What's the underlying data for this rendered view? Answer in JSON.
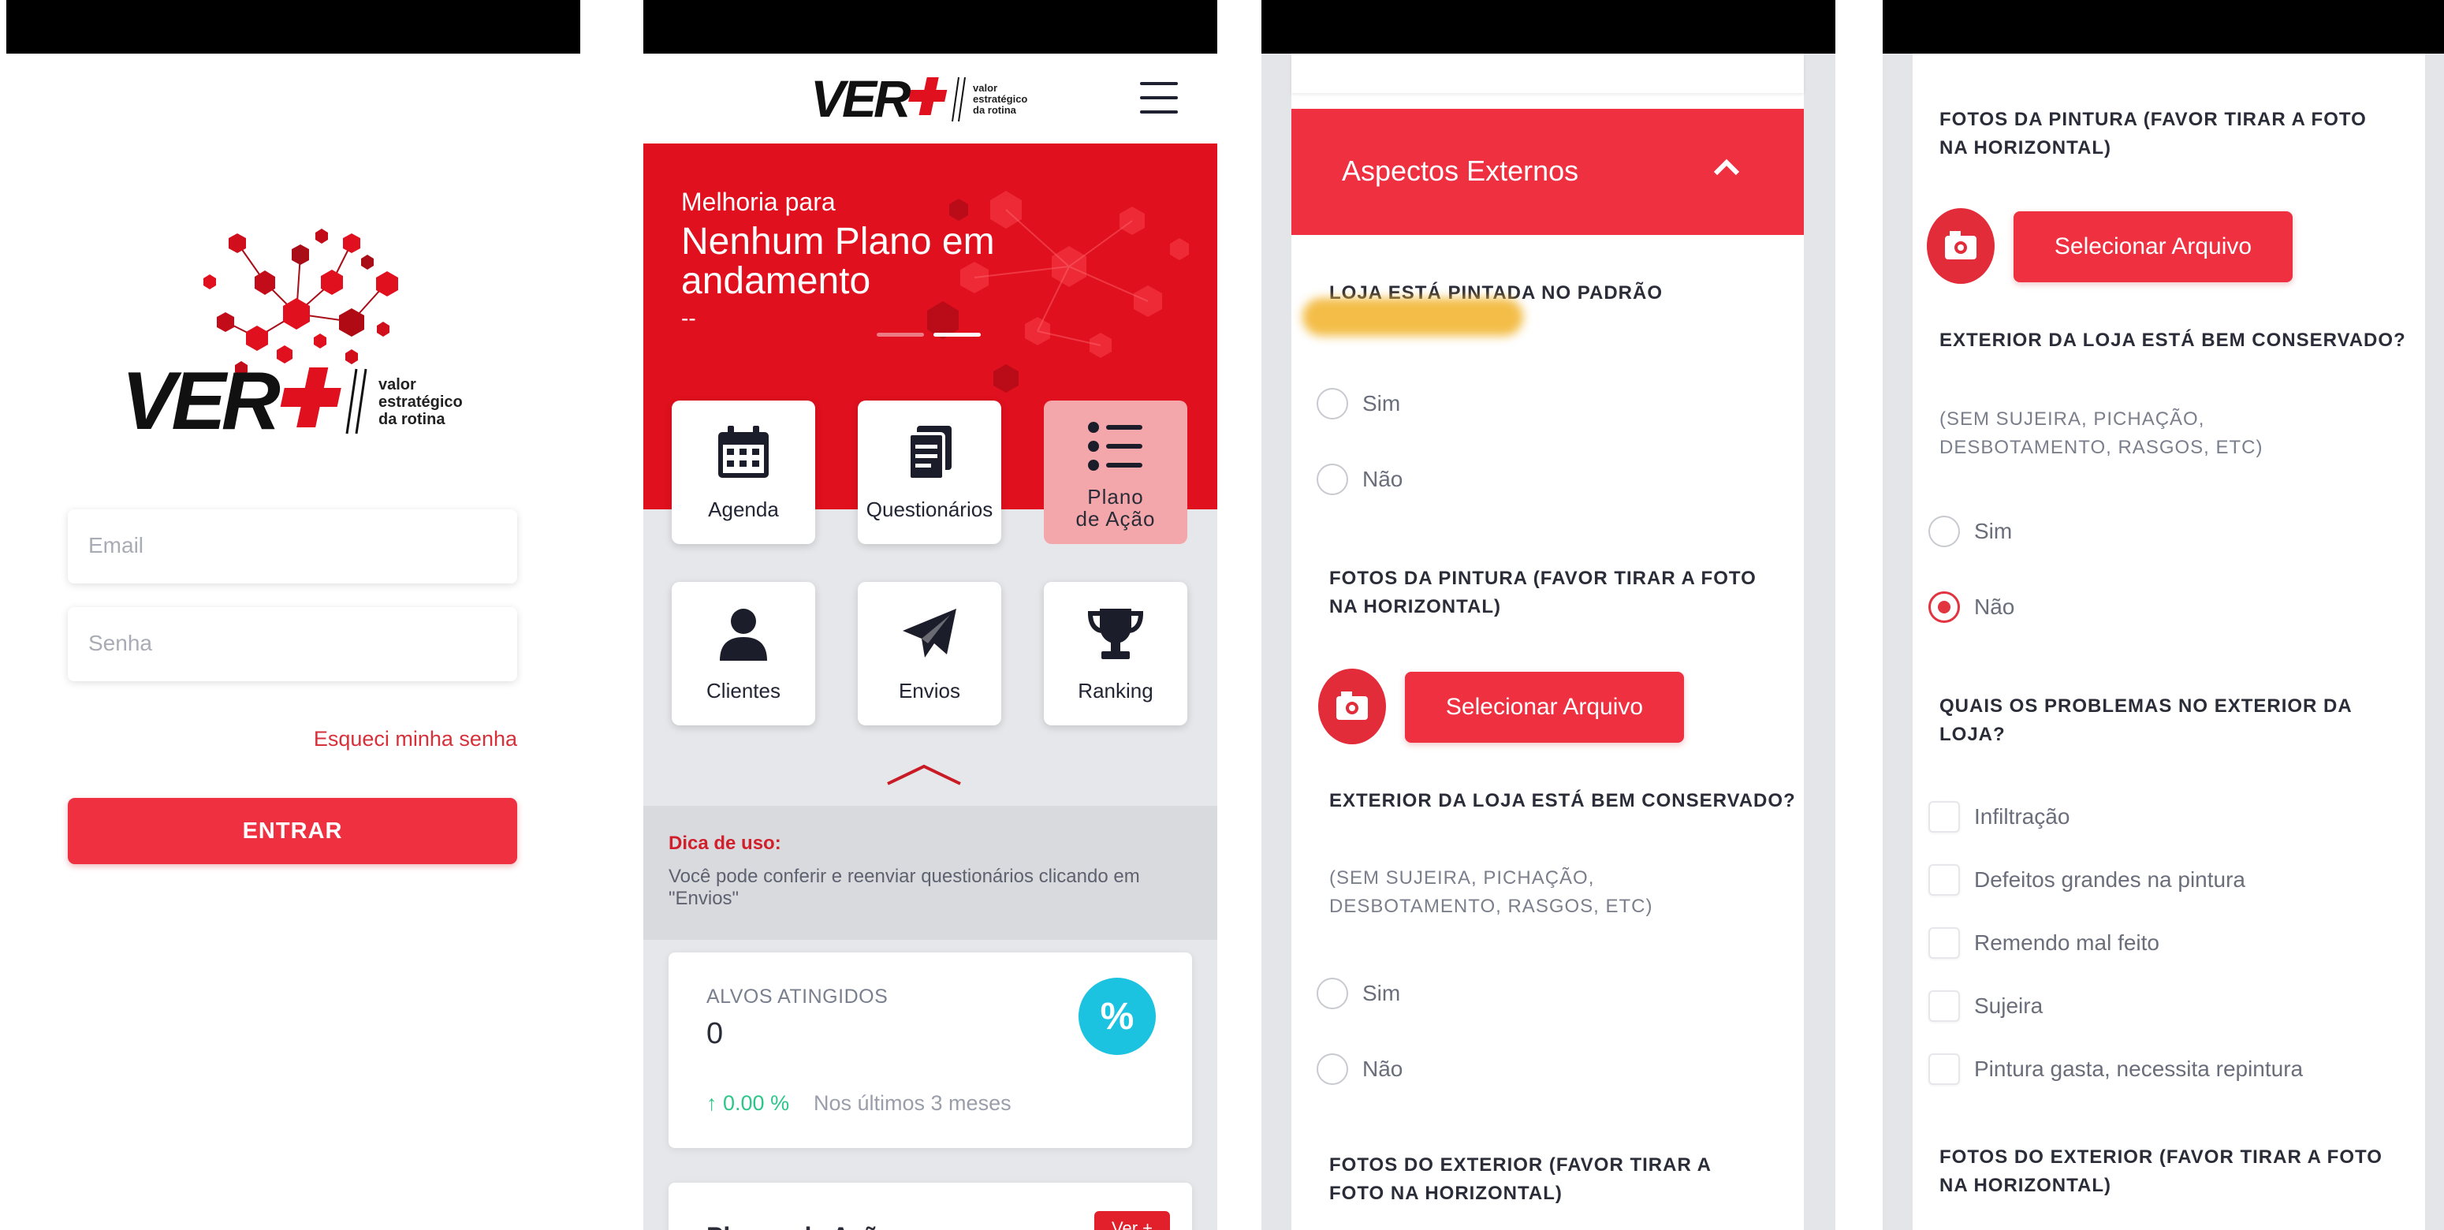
{
  "brand": {
    "wordmark_ver": "VER",
    "tagline": [
      "valor",
      "estratégico",
      "da rotina"
    ],
    "colors": {
      "primary": "#ee3040",
      "hero": "#e0101e",
      "accent_cyan": "#1bc3e0",
      "positive": "#2dc58a"
    }
  },
  "login": {
    "email_placeholder": "Email",
    "password_placeholder": "Senha",
    "forgot_password": "Esqueci minha senha",
    "submit": "ENTRAR"
  },
  "dashboard": {
    "hero": {
      "subtitle": "Melhoria para",
      "title": "Nenhum Plano em andamento",
      "detail": "--"
    },
    "menu": [
      {
        "label": "Agenda",
        "icon": "calendar-icon"
      },
      {
        "label": "Questionários",
        "icon": "document-icon"
      },
      {
        "label": "Plano de Ação",
        "icon": "list-icon",
        "active": true
      },
      {
        "label": "Clientes",
        "icon": "user-icon"
      },
      {
        "label": "Envios",
        "icon": "send-icon"
      },
      {
        "label": "Ranking",
        "icon": "trophy-icon"
      }
    ],
    "tip": {
      "title": "Dica de uso:",
      "text": "Você pode conferir e reenviar questionários clicando em \"Envios\""
    },
    "kpi": {
      "label": "ALVOS ATINGIDOS",
      "value": "0",
      "icon_text": "%",
      "trend": "0.00 %",
      "note": "Nos últimos 3 meses"
    },
    "plans": {
      "title": "Planos de Ação",
      "button": "Ver +"
    }
  },
  "form_screen_3": {
    "section_title": "Aspectos Externos",
    "q1": {
      "text": "LOJA ESTÁ PINTADA NO PADRÃO"
    },
    "q1_options": [
      "Sim",
      "Não"
    ],
    "q2": {
      "text": "FOTOS DA PINTURA (FAVOR TIRAR A FOTO NA HORIZONTAL)"
    },
    "upload_button": "Selecionar Arquivo",
    "q3": {
      "text": "EXTERIOR DA LOJA ESTÁ BEM CONSERVADO?",
      "hint": "(SEM SUJEIRA, PICHAÇÃO, DESBOTAMENTO, RASGOS, ETC)"
    },
    "q3_options": [
      "Sim",
      "Não"
    ],
    "q4": {
      "text": "FOTOS DO EXTERIOR (FAVOR TIRAR A FOTO NA HORIZONTAL)"
    }
  },
  "form_screen_4": {
    "q1": {
      "text": "FOTOS DA PINTURA (FAVOR TIRAR A FOTO NA HORIZONTAL)"
    },
    "upload_button": "Selecionar Arquivo",
    "q2": {
      "text": "EXTERIOR DA LOJA ESTÁ BEM CONSERVADO?",
      "hint": "(SEM SUJEIRA, PICHAÇÃO, DESBOTAMENTO, RASGOS, ETC)"
    },
    "q2_options": [
      "Sim",
      "Não"
    ],
    "q2_selected": "Não",
    "q3": {
      "text": "QUAIS OS PROBLEMAS NO EXTERIOR DA LOJA?"
    },
    "q3_options": [
      "Infiltração",
      "Defeitos grandes na pintura",
      "Remendo mal feito",
      "Sujeira",
      "Pintura gasta, necessita repintura"
    ],
    "q4": {
      "text": "FOTOS DO EXTERIOR (FAVOR TIRAR A FOTO NA HORIZONTAL)"
    }
  }
}
